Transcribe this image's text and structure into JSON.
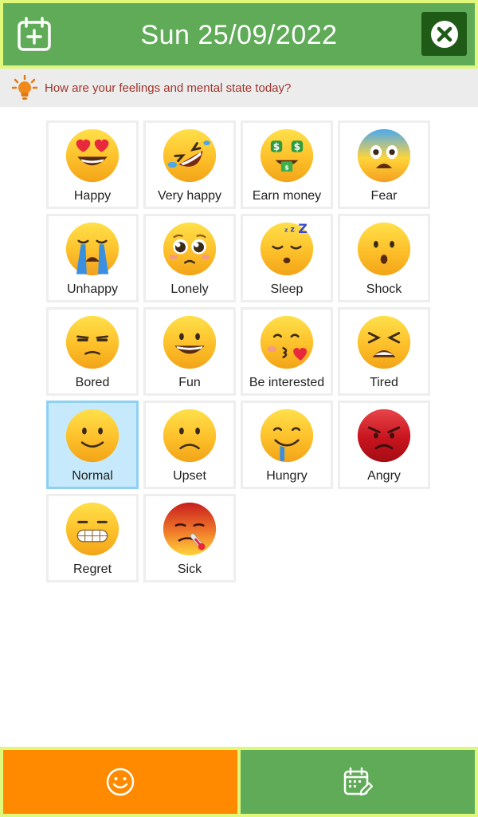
{
  "header": {
    "title": "Sun 25/09/2022",
    "add_icon": "calendar-add-icon",
    "close_icon": "close-icon",
    "background": "#5fab57",
    "close_background": "#1f5a17"
  },
  "prompt": {
    "icon": "lightbulb-icon",
    "text": "How are your feelings and mental state today?"
  },
  "moods": [
    {
      "label": "Happy",
      "icon": "heart-eyes-face-icon"
    },
    {
      "label": "Very happy",
      "icon": "rolling-laughing-face-icon"
    },
    {
      "label": "Earn money",
      "icon": "money-mouth-face-icon"
    },
    {
      "label": "Fear",
      "icon": "fearful-face-icon"
    },
    {
      "label": "Unhappy",
      "icon": "crying-face-icon"
    },
    {
      "label": "Lonely",
      "icon": "pleading-face-icon"
    },
    {
      "label": "Sleep",
      "icon": "sleeping-face-icon"
    },
    {
      "label": "Shock",
      "icon": "hushed-face-icon"
    },
    {
      "label": "Bored",
      "icon": "unamused-face-icon"
    },
    {
      "label": "Fun",
      "icon": "grinning-face-icon"
    },
    {
      "label": "Be interested",
      "icon": "kissing-face-icon"
    },
    {
      "label": "Tired",
      "icon": "tired-face-icon"
    },
    {
      "label": "Normal",
      "icon": "slightly-smiling-face-icon"
    },
    {
      "label": "Upset",
      "icon": "frowning-face-icon"
    },
    {
      "label": "Hungry",
      "icon": "drooling-face-icon"
    },
    {
      "label": "Angry",
      "icon": "angry-face-icon"
    },
    {
      "label": "Regret",
      "icon": "grimacing-face-icon"
    },
    {
      "label": "Sick",
      "icon": "thermometer-face-icon"
    }
  ],
  "selected_mood": "Normal",
  "bottom_tabs": {
    "mood_icon": "smiley-icon",
    "calendar_icon": "calendar-edit-icon",
    "mood_color": "#ff8a00",
    "calendar_color": "#5fab57"
  }
}
